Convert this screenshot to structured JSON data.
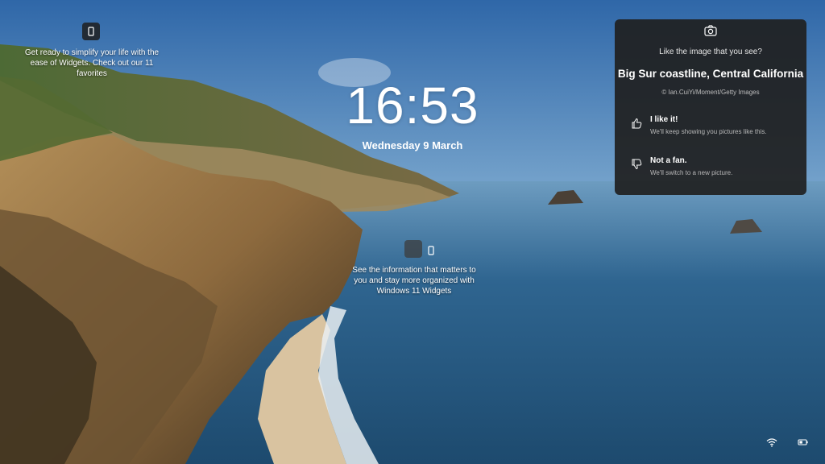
{
  "widget_hints": [
    {
      "text": "Get ready to simplify your life with the ease of Widgets. Check out our 11 favorites"
    },
    {
      "text": "See the information that matters to you and stay more organized with Windows 11 Widgets"
    }
  ],
  "clock": {
    "time": "16:53",
    "date": "Wednesday 9 March"
  },
  "spotlight": {
    "icon": "camera-icon",
    "question": "Like the image that you see?",
    "title": "Big Sur coastline, Central California",
    "credit": "© Ian.CuiYi/Moment/Getty Images",
    "options": [
      {
        "label": "I like it!",
        "sub": "We'll keep showing you pictures like this.",
        "icon": "thumbs-up-icon"
      },
      {
        "label": "Not a fan.",
        "sub": "We'll switch to a new picture.",
        "icon": "thumbs-down-icon"
      }
    ]
  },
  "tray": {
    "wifi_icon": "wifi-icon",
    "battery_icon": "battery-icon"
  },
  "colors": {
    "panel_bg": "#202020",
    "sky_top": "#2f67a8",
    "sea": "#2a5c86"
  }
}
